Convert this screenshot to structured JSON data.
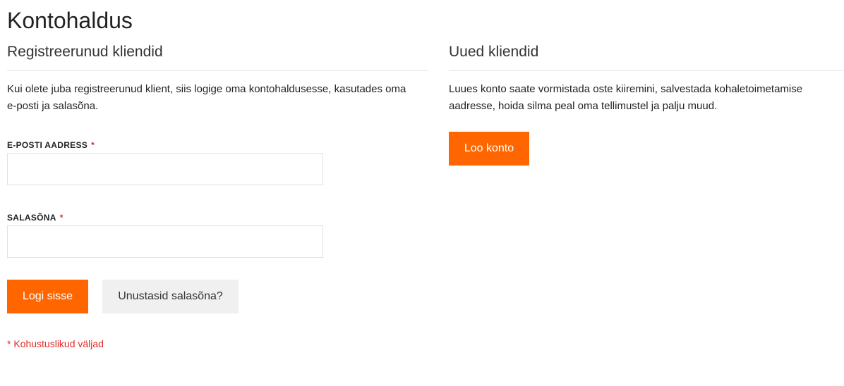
{
  "page": {
    "title": "Kontohaldus"
  },
  "registered": {
    "title": "Registreerunud kliendid",
    "intro": "Kui olete juba registreerunud klient, siis logige oma kontohaldusesse, kasutades oma e-posti ja salasõna.",
    "email_label": "E-POSTI AADRESS",
    "email_value": "",
    "password_label": "SALASÕNA",
    "password_value": "",
    "required_star": "*",
    "login_button": "Logi sisse",
    "forgot_button": "Unustasid salasõna?",
    "required_note": "* Kohustuslikud väljad"
  },
  "new_customers": {
    "title": "Uued kliendid",
    "intro": "Luues konto saate vormistada oste kiiremini, salvestada kohaletoimetamise aadresse, hoida silma peal oma tellimustel ja palju muud.",
    "create_button": "Loo konto"
  },
  "colors": {
    "accent": "#ff6600",
    "required": "#e02b27",
    "secondary_button": "#f0f0f0",
    "border": "#e2e2e2"
  }
}
